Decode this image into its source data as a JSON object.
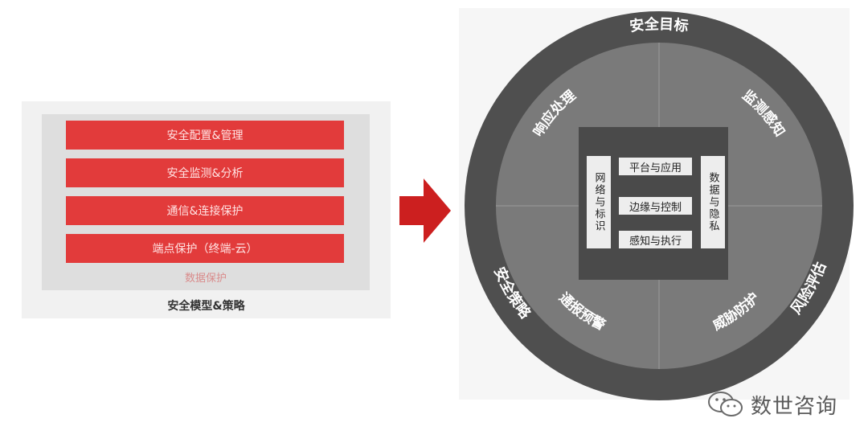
{
  "left_model": {
    "layers": [
      "安全配置&管理",
      "安全监测&分析",
      "通信&连接保护",
      "端点保护（终端-云）"
    ],
    "base_label": "数据保护",
    "caption": "安全模型&策略"
  },
  "right_model": {
    "outer_ring": {
      "top": "安全目标",
      "left": "安全策略",
      "right": "风险评估"
    },
    "quadrants": {
      "top_left": "响应处理",
      "top_right": "监测感知",
      "bottom_left": "通报预警",
      "bottom_right": "威胁防护"
    },
    "core": {
      "left_column": "网络与标识",
      "right_column": "数据与隐私",
      "rows": [
        "平台与应用",
        "边缘与控制",
        "感知与执行"
      ]
    }
  },
  "watermark": {
    "text": "数世咨询"
  },
  "colors": {
    "layer_red": "#e23b3b",
    "arrow_red": "#cc1f1f",
    "outer_ring": "#4f4f4f",
    "inner_circle": "#7a7a7a",
    "core_square": "#4a4a4a"
  }
}
